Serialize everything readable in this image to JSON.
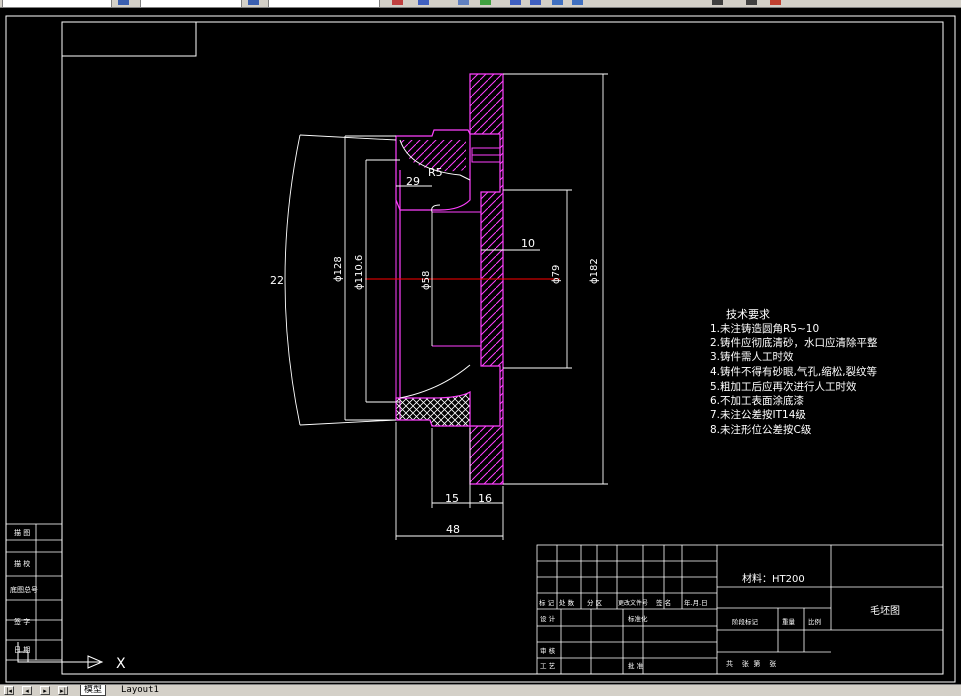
{
  "tabs": {
    "model": "模型",
    "layout1": "Layout1"
  },
  "drawing": {
    "dims": {
      "r5": "R5",
      "d29": "29",
      "d22": "22",
      "phi128": "ϕ128",
      "phi1106": "ϕ110.6",
      "phi58": "ϕ58",
      "d10": "10",
      "phi79": "ϕ79",
      "phi182": "ϕ182",
      "d15": "15",
      "d16": "16",
      "d48": "48"
    },
    "tech_title": "技术要求",
    "tech_items": [
      "1.未注铸造圆角R5~10",
      "2.铸件应彻底清砂，水口应清除平整",
      "3.铸件需人工时效",
      "4.铸件不得有砂眼,气孔,缩松,裂纹等",
      "5.粗加工后应再次进行人工时效",
      "6.不加工表面涂底漆",
      "7.未注公差按IT14级",
      "8.未注形位公差按C级"
    ],
    "title_block": {
      "material": "材料：HT200",
      "drawing_name": "毛坯图",
      "row_labels": [
        "标 记",
        "处 数",
        "分 区",
        "更改文件号",
        "签 名",
        "年.月.日"
      ],
      "design": "设 计",
      "standardize": "标准化",
      "review": "审 核",
      "process": "工 艺",
      "approve": "批 准",
      "stage_mark": "阶段标记",
      "weight": "重量",
      "scale": "比例",
      "sheets": "共    张  第    张"
    },
    "side_table": {
      "labels": [
        "描 图",
        "描 校",
        "底图总号",
        "签 字",
        "日 期"
      ]
    },
    "ucs_x": "X"
  },
  "colors": {
    "outline": "#ffffff",
    "section": "#ff40ff",
    "center": "#ff0000",
    "background": "#000000"
  }
}
